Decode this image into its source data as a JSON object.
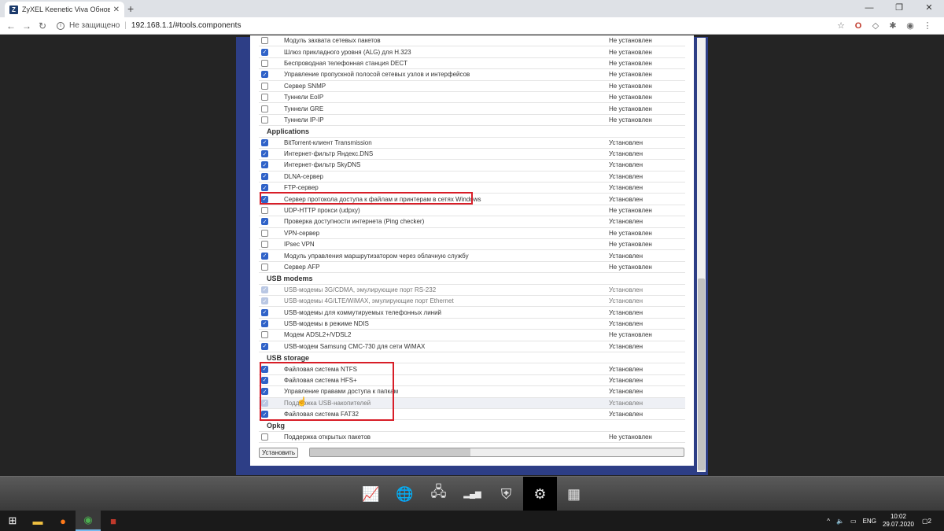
{
  "browser": {
    "tab_title": "ZyXEL Keenetic Viva Обновлени",
    "tab_favicon": "Z",
    "security_label": "Не защищено",
    "url": "192.168.1.1/#tools.components"
  },
  "components": [
    {
      "type": "item",
      "checked": false,
      "disabled": false,
      "name": "Модуль захвата сетевых пакетов",
      "status": "Не установлен"
    },
    {
      "type": "item",
      "checked": true,
      "disabled": false,
      "name": "Шлюз прикладного уровня (ALG) для H.323",
      "status": "Не установлен"
    },
    {
      "type": "item",
      "checked": false,
      "disabled": false,
      "name": "Беспроводная телефонная станция DECT",
      "status": "Не установлен"
    },
    {
      "type": "item",
      "checked": true,
      "disabled": false,
      "name": "Управление пропускной полосой сетевых узлов и интерфейсов",
      "status": "Не установлен"
    },
    {
      "type": "item",
      "checked": false,
      "disabled": false,
      "name": "Сервер SNMP",
      "status": "Не установлен"
    },
    {
      "type": "item",
      "checked": false,
      "disabled": false,
      "name": "Туннели EoIP",
      "status": "Не установлен"
    },
    {
      "type": "item",
      "checked": false,
      "disabled": false,
      "name": "Туннели GRE",
      "status": "Не установлен"
    },
    {
      "type": "item",
      "checked": false,
      "disabled": false,
      "name": "Туннели IP-IP",
      "status": "Не установлен"
    },
    {
      "type": "group",
      "name": "Applications"
    },
    {
      "type": "item",
      "checked": true,
      "disabled": false,
      "name": "BitTorrent-клиент Transmission",
      "status": "Установлен"
    },
    {
      "type": "item",
      "checked": true,
      "disabled": false,
      "name": "Интернет-фильтр Яндекс.DNS",
      "status": "Установлен"
    },
    {
      "type": "item",
      "checked": true,
      "disabled": false,
      "name": "Интернет-фильтр SkyDNS",
      "status": "Установлен"
    },
    {
      "type": "item",
      "checked": true,
      "disabled": false,
      "name": "DLNA-сервер",
      "status": "Установлен"
    },
    {
      "type": "item",
      "checked": true,
      "disabled": false,
      "name": "FTP-сервер",
      "status": "Установлен"
    },
    {
      "type": "item",
      "checked": true,
      "disabled": false,
      "name": "Сервер протокола доступа к файлам и принтерам в сетях Windows",
      "status": "Установлен"
    },
    {
      "type": "item",
      "checked": false,
      "disabled": false,
      "name": "UDP-HTTP прокси (udpxy)",
      "status": "Не установлен"
    },
    {
      "type": "item",
      "checked": true,
      "disabled": false,
      "name": "Проверка доступности интернета (Ping checker)",
      "status": "Установлен"
    },
    {
      "type": "item",
      "checked": false,
      "disabled": false,
      "name": "VPN-сервер",
      "status": "Не установлен"
    },
    {
      "type": "item",
      "checked": false,
      "disabled": false,
      "name": "IPsec VPN",
      "status": "Не установлен"
    },
    {
      "type": "item",
      "checked": true,
      "disabled": false,
      "name": "Модуль управления маршрутизатором через облачную службу",
      "status": "Установлен"
    },
    {
      "type": "item",
      "checked": false,
      "disabled": false,
      "name": "Сервер AFP",
      "status": "Не установлен"
    },
    {
      "type": "group",
      "name": "USB modems"
    },
    {
      "type": "item",
      "checked": true,
      "disabled": true,
      "name": "USB-модемы 3G/CDMA, эмулирующие порт RS-232",
      "status": "Установлен"
    },
    {
      "type": "item",
      "checked": true,
      "disabled": true,
      "name": "USB-модемы 4G/LTE/WiMAX, эмулирующие порт Ethernet",
      "status": "Установлен"
    },
    {
      "type": "item",
      "checked": true,
      "disabled": false,
      "name": "USB-модемы для коммутируемых телефонных линий",
      "status": "Установлен"
    },
    {
      "type": "item",
      "checked": true,
      "disabled": false,
      "name": "USB-модемы в режиме NDIS",
      "status": "Установлен"
    },
    {
      "type": "item",
      "checked": false,
      "disabled": false,
      "name": "Модем ADSL2+/VDSL2",
      "status": "Не установлен"
    },
    {
      "type": "item",
      "checked": true,
      "disabled": false,
      "name": "USB-модем Samsung CMC-730 для сети WiMAX",
      "status": "Установлен"
    },
    {
      "type": "group",
      "name": "USB storage"
    },
    {
      "type": "item",
      "checked": true,
      "disabled": false,
      "name": "Файловая система NTFS",
      "status": "Установлен"
    },
    {
      "type": "item",
      "checked": true,
      "disabled": false,
      "name": "Файловая система HFS+",
      "status": "Установлен"
    },
    {
      "type": "item",
      "checked": true,
      "disabled": false,
      "name": "Управление правами доступа к папкам",
      "status": "Установлен"
    },
    {
      "type": "item",
      "checked": true,
      "disabled": true,
      "name": "Поддержка USB-накопителей",
      "status": "Установлен",
      "hover": true
    },
    {
      "type": "item",
      "checked": true,
      "disabled": false,
      "name": "Файловая система FAT32",
      "status": "Установлен"
    },
    {
      "type": "group",
      "name": "Opkg"
    },
    {
      "type": "item",
      "checked": false,
      "disabled": false,
      "name": "Поддержка открытых пакетов",
      "status": "Не установлен"
    }
  ],
  "install_button_label": "Установить",
  "progress_fraction": 0.43,
  "dock_icons": [
    "monitor-graph-icon",
    "globe-icon",
    "network-icon",
    "signal-bars-icon",
    "shield-icon",
    "gear-icon",
    "apps-grid-icon"
  ],
  "dock_active": "gear-icon",
  "taskbar": {
    "language": "ENG",
    "time": "10:02",
    "date": "29.07.2020",
    "notifications": "2"
  }
}
